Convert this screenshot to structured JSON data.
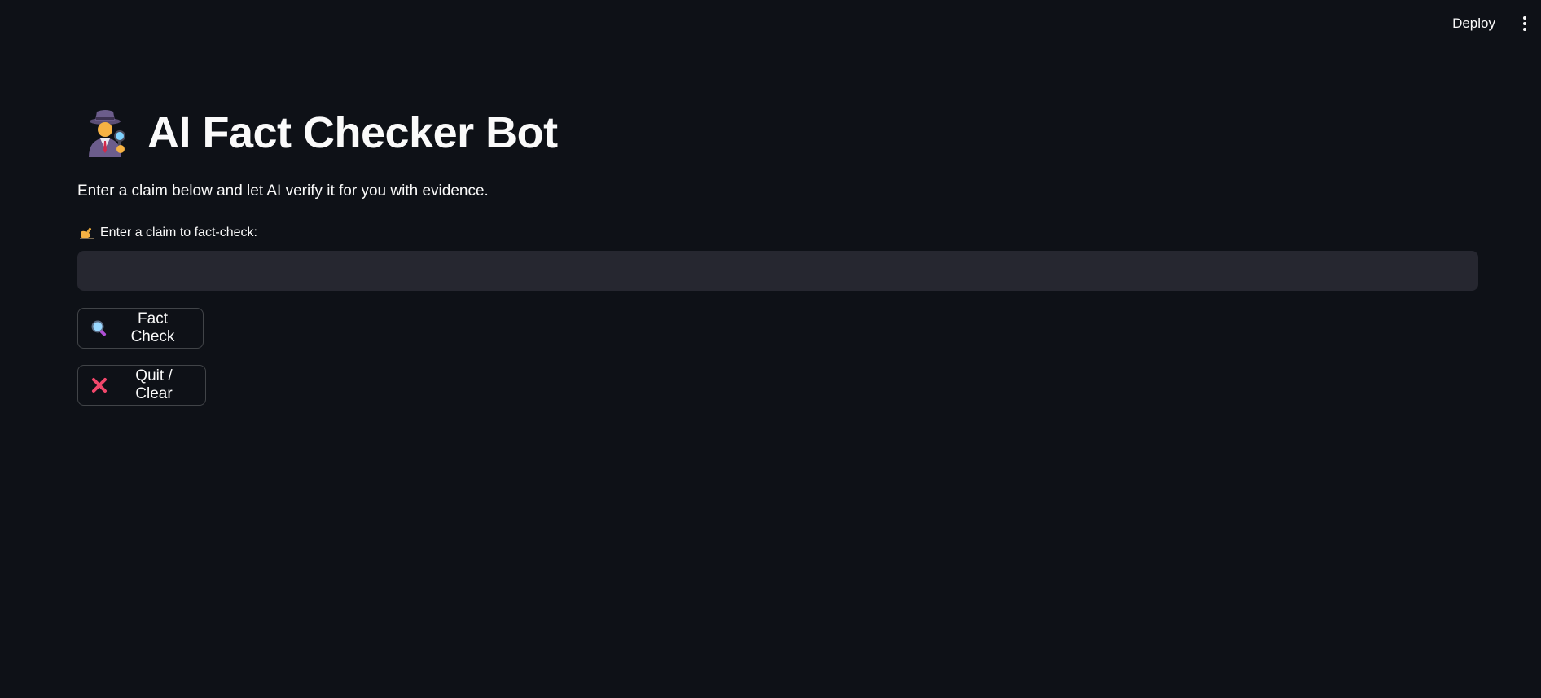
{
  "header": {
    "deploy_label": "Deploy",
    "menu_icon": "vertical-dots-icon"
  },
  "main": {
    "title": "AI Fact Checker Bot",
    "title_icon": "detective-icon",
    "subtitle": "Enter a claim below and let AI verify it for you with evidence.",
    "claim_field": {
      "label": "Enter a claim to fact-check:",
      "label_icon": "writing-hand-icon",
      "value": "",
      "placeholder": ""
    },
    "buttons": {
      "fact_check": {
        "label": "Fact Check",
        "icon": "magnifying-glass-icon"
      },
      "quit_clear": {
        "label": "Quit / Clear",
        "icon": "cross-mark-icon"
      }
    }
  },
  "colors": {
    "background": "#0e1117",
    "input_background": "#262730",
    "text": "#fafafa",
    "cross_red": "#f1476b"
  }
}
